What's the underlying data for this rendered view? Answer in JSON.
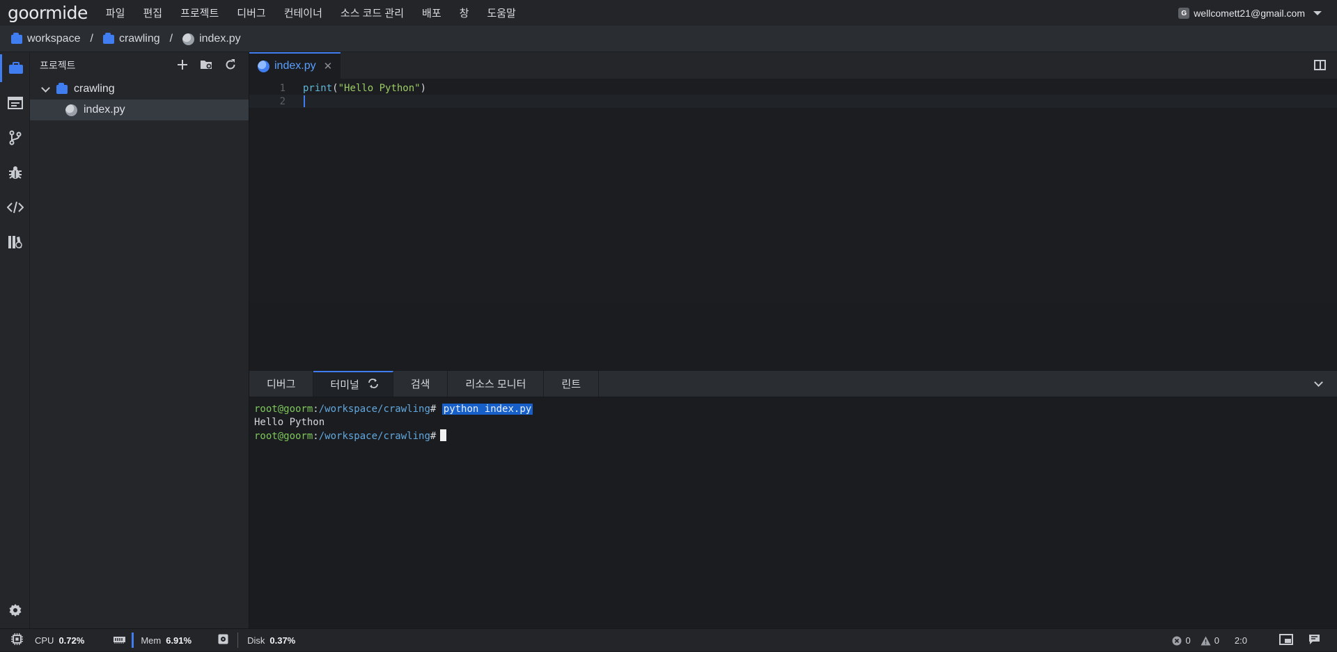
{
  "app": {
    "logo": "goormide"
  },
  "menu": [
    "파일",
    "편집",
    "프로젝트",
    "디버그",
    "컨테이너",
    "소스 코드 관리",
    "배포",
    "창",
    "도움말"
  ],
  "account": {
    "badge": "G",
    "email": "wellcomett21@gmail.com"
  },
  "breadcrumb": [
    {
      "label": "workspace",
      "icon": "folder-icon"
    },
    {
      "label": "crawling",
      "icon": "folder-icon"
    },
    {
      "label": "index.py",
      "icon": "python-icon"
    }
  ],
  "breadcrumb_sep": "/",
  "toolbar_icons": [
    "save-icon",
    "save-all-icon",
    "find-icon",
    "wrench-icon",
    "run-icon",
    "flask-icon",
    "collapse-icon"
  ],
  "sidebar_icons": [
    "project-icon",
    "terminal-window-icon",
    "git-branch-icon",
    "bug-icon",
    "code-icon",
    "library-icon",
    "settings-icon"
  ],
  "explorer": {
    "title": "프로젝트",
    "tree": [
      {
        "label": "crawling",
        "type": "folder",
        "expanded": true
      },
      {
        "label": "index.py",
        "type": "file",
        "selected": true
      }
    ]
  },
  "editor": {
    "tab": {
      "label": "index.py",
      "close": "✕"
    },
    "lines": [
      {
        "num": "1",
        "kw": "print",
        "open": "(",
        "str": "\"Hello Python\"",
        "close": ")"
      },
      {
        "num": "2"
      }
    ]
  },
  "panel": {
    "tabs": [
      {
        "label": "디버그",
        "active": false
      },
      {
        "label": "터미널",
        "active": true
      },
      {
        "label": "검색",
        "active": false
      },
      {
        "label": "리소스 모니터",
        "active": false
      },
      {
        "label": "린트",
        "active": false
      }
    ],
    "terminal": {
      "user": "root@goorm",
      "colon": ":",
      "path": "/workspace/crawling",
      "hash": "#",
      "command": "python index.py ",
      "output": "Hello Python"
    }
  },
  "status": {
    "cpu": {
      "label": "CPU",
      "value": "0.72%"
    },
    "mem": {
      "label": "Mem",
      "value": "6.91%"
    },
    "disk": {
      "label": "Disk",
      "value": "0.37%"
    },
    "errors": "0",
    "warnings": "0",
    "cursor_pos": "2:0"
  },
  "colors": {
    "accent": "#3f7df0",
    "bg": "#1a1c1f",
    "panel": "#24262a",
    "selection": "#1760c9"
  }
}
